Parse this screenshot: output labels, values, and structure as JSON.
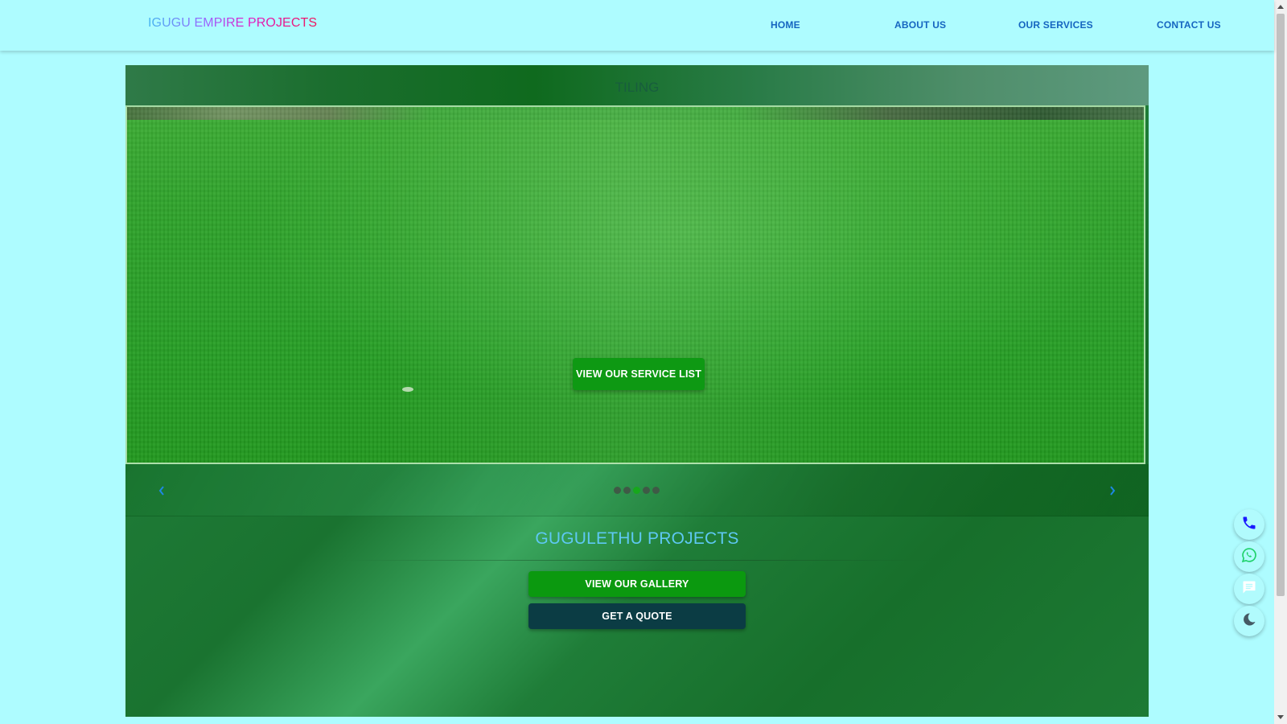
{
  "header": {
    "brand": "IGUGU EMPIRE PROJECTS",
    "nav": [
      {
        "label": "HOME"
      },
      {
        "label": "ABOUT US"
      },
      {
        "label": "OUR SERVICES"
      },
      {
        "label": "CONTACT US"
      }
    ]
  },
  "carousel": {
    "slide_title": "TILING",
    "cta_label": "VIEW OUR SERVICE LIST",
    "prev_icon": "chevron-left-icon",
    "next_icon": "chevron-right-icon",
    "dot_count": 5,
    "active_dot": 3
  },
  "section": {
    "title": "GUGULETHU PROJECTS",
    "gallery_button": "VIEW OUR GALLERY",
    "quote_button": "GET A QUOTE"
  },
  "floating_actions": [
    {
      "icon": "phone-icon",
      "color": "#1a1aff"
    },
    {
      "icon": "whatsapp-icon",
      "color": "#1fd16a"
    },
    {
      "icon": "chat-icon",
      "color": "#ffffff"
    },
    {
      "icon": "moon-icon",
      "color": "#455a64"
    }
  ],
  "colors": {
    "page_bg": "#aefcff",
    "nav_link": "#1565c0",
    "primary_button": "#0b990f",
    "quote_button": "#0b3c44",
    "section_title": "#5ec8f3"
  }
}
